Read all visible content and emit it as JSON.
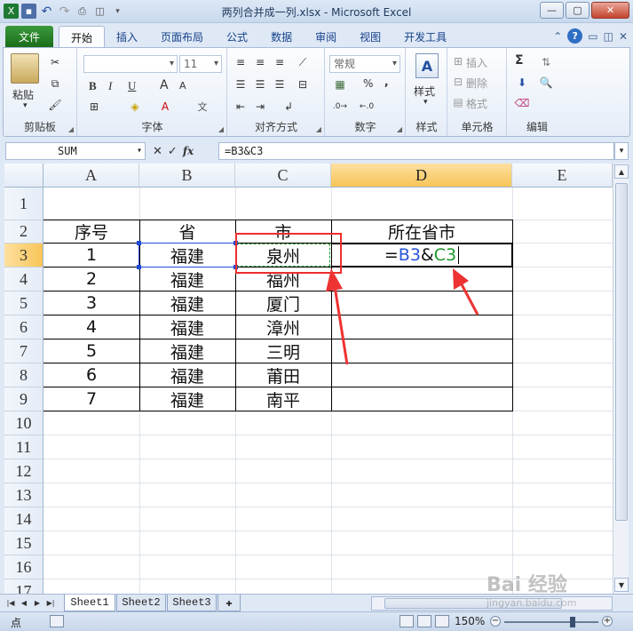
{
  "app": {
    "title": "两列合并成一列.xlsx - Microsoft Excel",
    "app_icon": "X"
  },
  "ribbon_tabs": {
    "file": "文件",
    "items": [
      "开始",
      "插入",
      "页面布局",
      "公式",
      "数据",
      "审阅",
      "视图",
      "开发工具"
    ],
    "active": "开始"
  },
  "ribbon": {
    "clipboard": {
      "label": "剪贴板",
      "paste": "粘贴"
    },
    "font": {
      "label": "字体",
      "size": "11",
      "bold": "B",
      "italic": "I",
      "underline": "U",
      "grow": "A",
      "shrink": "A"
    },
    "alignment": {
      "label": "对齐方式"
    },
    "number": {
      "label": "数字",
      "format": "常规",
      "percent": "%",
      "comma": ","
    },
    "styles": {
      "label": "样式",
      "button": "样式"
    },
    "cells": {
      "label": "单元格",
      "insert": "插入",
      "delete": "删除",
      "format": "格式"
    },
    "editing": {
      "label": "编辑",
      "sum": "Σ"
    }
  },
  "formula_bar": {
    "name_box": "SUM",
    "cancel": "✕",
    "enter": "✓",
    "fx": "fx",
    "formula": "=B3&C3"
  },
  "grid": {
    "columns": [
      "A",
      "B",
      "C",
      "D",
      "E"
    ],
    "rows": [
      "1",
      "2",
      "3",
      "4",
      "5",
      "6",
      "7",
      "8",
      "9",
      "10",
      "11",
      "12",
      "13",
      "14",
      "15",
      "16",
      "17"
    ],
    "header": {
      "a": "序号",
      "b": "省",
      "c": "市",
      "d": "所在省市"
    },
    "data": [
      {
        "a": "1",
        "b": "福建",
        "c": "泉州"
      },
      {
        "a": "2",
        "b": "福建",
        "c": "福州"
      },
      {
        "a": "3",
        "b": "福建",
        "c": "厦门"
      },
      {
        "a": "4",
        "b": "福建",
        "c": "漳州"
      },
      {
        "a": "5",
        "b": "福建",
        "c": "三明"
      },
      {
        "a": "6",
        "b": "福建",
        "c": "莆田"
      },
      {
        "a": "7",
        "b": "福建",
        "c": "南平"
      }
    ],
    "editing_formula": {
      "eq": "=",
      "ref1": "B3",
      "amp": "&",
      "ref2": "C3"
    }
  },
  "sheet_tabs": [
    "Sheet1",
    "Sheet2",
    "Sheet3"
  ],
  "status": {
    "mode": "点",
    "zoom": "150%"
  },
  "watermark": {
    "brand": "Bai 经验",
    "url": "jingyan.baidu.com"
  },
  "colors": {
    "ref1": "#2a55d8",
    "ref2": "#1b9a2a",
    "annotation": "#ee2e2e",
    "file_tab": "#1c6d1c"
  }
}
